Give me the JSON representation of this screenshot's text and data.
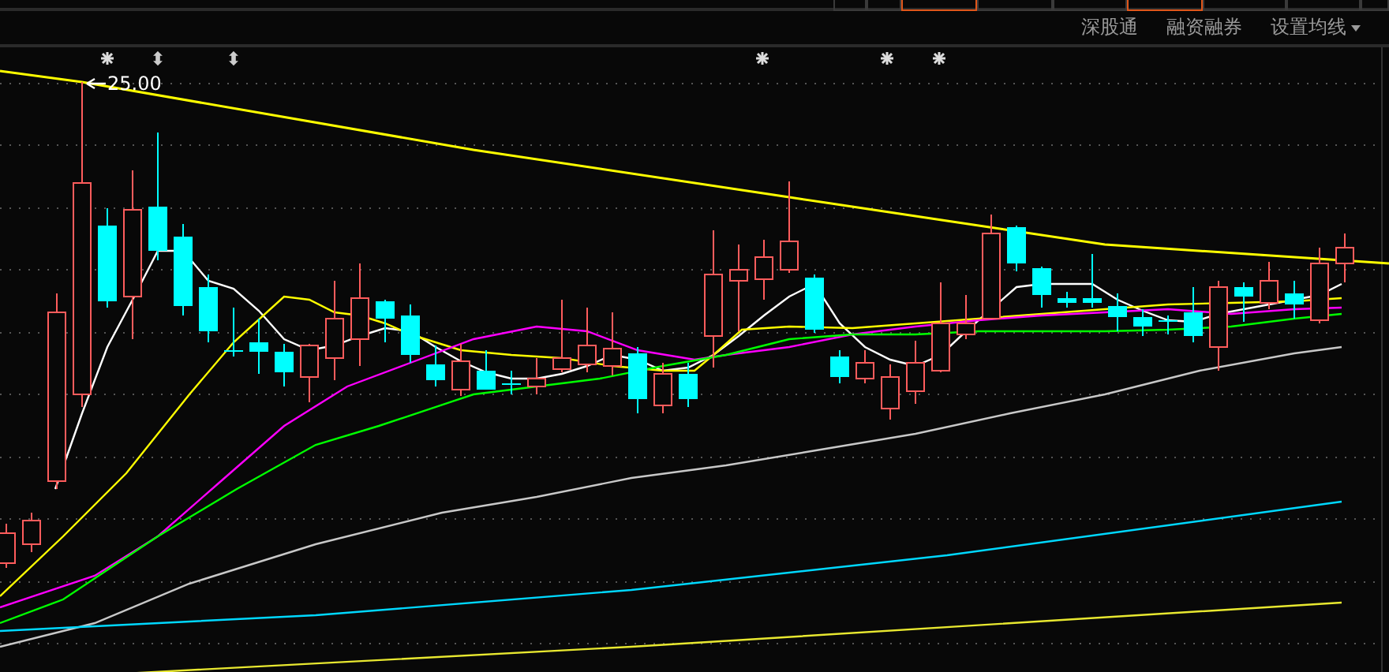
{
  "top_tabs": [
    {
      "selected": false
    },
    {
      "selected": false
    },
    {
      "selected": true
    },
    {
      "selected": false
    },
    {
      "selected": false
    },
    {
      "selected": true
    },
    {
      "selected": false
    },
    {
      "selected": false
    },
    {
      "selected": false
    }
  ],
  "toolbar": {
    "buttons": [
      {
        "label": "深股通",
        "has_menu": false
      },
      {
        "label": "融资融券",
        "has_menu": false
      },
      {
        "label": "设置均线",
        "has_menu": true
      }
    ]
  },
  "chart": {
    "high_label": "25.00"
  }
}
